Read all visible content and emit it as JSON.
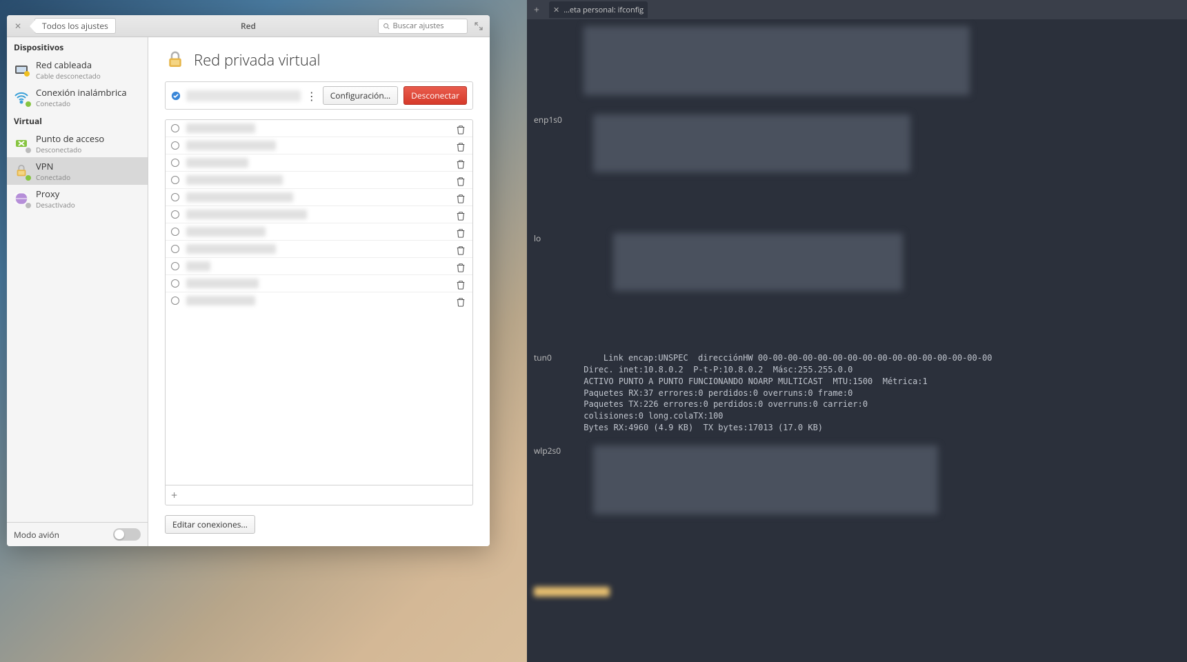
{
  "settings": {
    "back_label": "Todos los ajustes",
    "window_title": "Red",
    "search_placeholder": "Buscar ajustes",
    "sections": {
      "devices_header": "Dispositivos",
      "virtual_header": "Virtual"
    },
    "items": {
      "wired": {
        "label": "Red cableada",
        "sub": "Cable desconectado"
      },
      "wifi": {
        "label": "Conexión inalámbrica",
        "sub": "Conectado"
      },
      "hotspot": {
        "label": "Punto de acceso",
        "sub": "Desconectado"
      },
      "vpn": {
        "label": "VPN",
        "sub": "Conectado"
      },
      "proxy": {
        "label": "Proxy",
        "sub": "Desactivado"
      }
    },
    "airplane_label": "Modo avión"
  },
  "vpn_panel": {
    "title": "Red privada virtual",
    "configure_label": "Configuración...",
    "disconnect_label": "Desconectar",
    "edit_label": "Editar conexiones...",
    "entries_count": 11
  },
  "terminal": {
    "tab_title": "...eta personal: ifconfig",
    "interfaces": [
      "enp1s0",
      "lo",
      "tun0",
      "wlp2s0"
    ],
    "tun0_lines": [
      "Link encap:UNSPEC  direcciónHW 00-00-00-00-00-00-00-00-00-00-00-00-00-00-00-00",
      "Direc. inet:10.8.0.2  P-t-P:10.8.0.2  Másc:255.255.0.0",
      "ACTIVO PUNTO A PUNTO FUNCIONANDO NOARP MULTICAST  MTU:1500  Métrica:1",
      "Paquetes RX:37 errores:0 perdidos:0 overruns:0 frame:0",
      "Paquetes TX:226 errores:0 perdidos:0 overruns:0 carrier:0",
      "colisiones:0 long.colaTX:100",
      "Bytes RX:4960 (4.9 KB)  TX bytes:17013 (17.0 KB)"
    ]
  }
}
